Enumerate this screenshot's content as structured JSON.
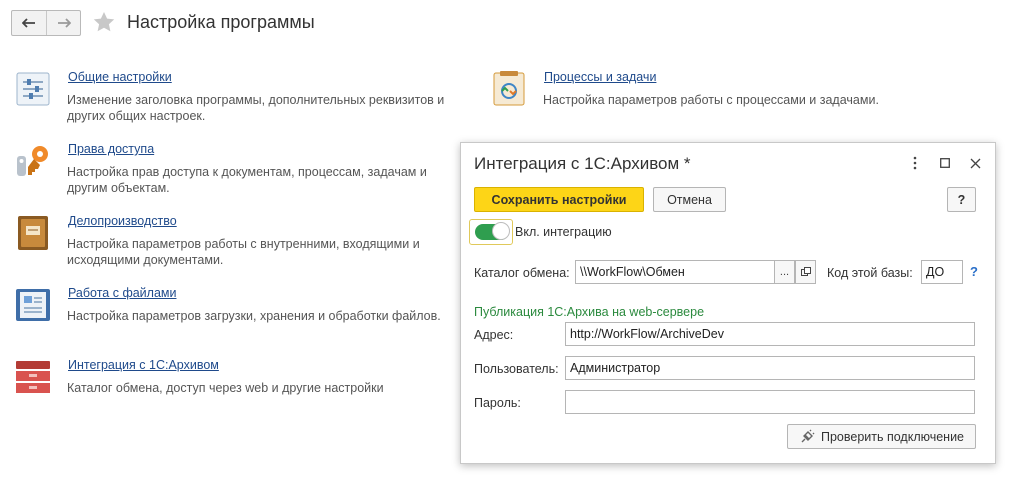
{
  "header": {
    "title": "Настройка программы",
    "back_icon": "arrow-left-icon",
    "forward_icon": "arrow-right-icon",
    "favorite_icon": "star-icon"
  },
  "sections": [
    {
      "link": "Общие настройки",
      "desc1": "Изменение заголовка программы, дополнительных реквизитов и",
      "desc2": "других общих настроек.",
      "icon": "sliders-icon"
    },
    {
      "link": "Права доступа",
      "desc1": "Настройка прав доступа к документам, процессам, задачам и",
      "desc2": "другим объектам.",
      "icon": "keys-icon"
    },
    {
      "link": "Делопроизводство",
      "desc1": "Настройка параметров работы с внутренними, входящими и",
      "desc2": "исходящими документами.",
      "icon": "folder-icon"
    },
    {
      "link": "Работа с файлами",
      "desc1": "Настройка параметров загрузки, хранения и обработки файлов.",
      "desc2": "",
      "icon": "document-icon"
    },
    {
      "link": "Интеграция с 1С:Архивом",
      "desc1": "Каталог обмена, доступ через web и другие настройки",
      "desc2": "",
      "icon": "archive-box-icon"
    },
    {
      "link": "Процессы и задачи",
      "desc1": "Настройка параметров работы с процессами и задачами.",
      "desc2": "",
      "icon": "process-icon"
    }
  ],
  "dialog": {
    "title": "Интеграция с 1С:Архивом *",
    "save_label": "Сохранить настройки",
    "cancel_label": "Отмена",
    "help_label": "?",
    "toggle_label": "Вкл. интеграцию",
    "toggle_on": true,
    "exchange_label": "Каталог обмена:",
    "exchange_value": "\\\\WorkFlow\\Обмен",
    "exchange_select_label": "...",
    "base_code_label": "Код этой базы:",
    "base_code_value": "ДО",
    "base_code_help": "?",
    "publication_heading": "Публикация 1С:Архива на web-сервере",
    "address_label": "Адрес:",
    "address_value": "http://WorkFlow/ArchiveDev",
    "user_label": "Пользователь:",
    "user_value": "Администратор",
    "password_label": "Пароль:",
    "password_value": "",
    "check_label": "Проверить подключение",
    "accent_color": "#fdd517",
    "toggle_color": "#2f9e4f"
  }
}
